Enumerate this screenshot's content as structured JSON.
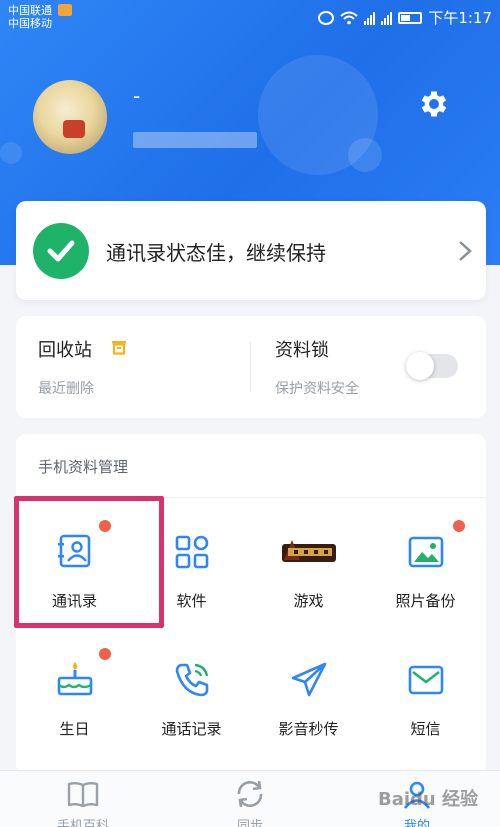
{
  "status_bar": {
    "carrier_1": "中国联通",
    "carrier_2": "中国移动",
    "time": "下午1:17"
  },
  "profile": {
    "name": "-"
  },
  "health": {
    "text": "通讯录状态佳，继续保持"
  },
  "tools": {
    "recycle_title": "回收站",
    "recycle_sub": "最近删除",
    "lock_title": "资料锁",
    "lock_sub": "保护资料安全"
  },
  "manage": {
    "title": "手机资料管理",
    "items": [
      {
        "label": "通讯录",
        "icon": "contacts-icon"
      },
      {
        "label": "软件",
        "icon": "apps-grid-icon"
      },
      {
        "label": "游戏",
        "icon": "game-logo"
      },
      {
        "label": "照片备份",
        "icon": "photo-icon"
      },
      {
        "label": "生日",
        "icon": "cake-icon"
      },
      {
        "label": "通话记录",
        "icon": "phone-icon"
      },
      {
        "label": "影音秒传",
        "icon": "send-icon"
      },
      {
        "label": "短信",
        "icon": "mail-icon"
      }
    ]
  },
  "bottom_nav": {
    "items": [
      {
        "label": "手机百科",
        "icon": "book-icon"
      },
      {
        "label": "同步",
        "icon": "sync-icon"
      },
      {
        "label": "我的",
        "icon": "person-icon"
      }
    ],
    "active_index": 2
  },
  "watermark": "Baidu 经验",
  "colors": {
    "brand_blue": "#2f86f6",
    "success_green": "#1fb36a",
    "badge_red": "#f0604d",
    "highlight_pink": "#d6336f",
    "trash_yellow": "#f2b31b"
  }
}
